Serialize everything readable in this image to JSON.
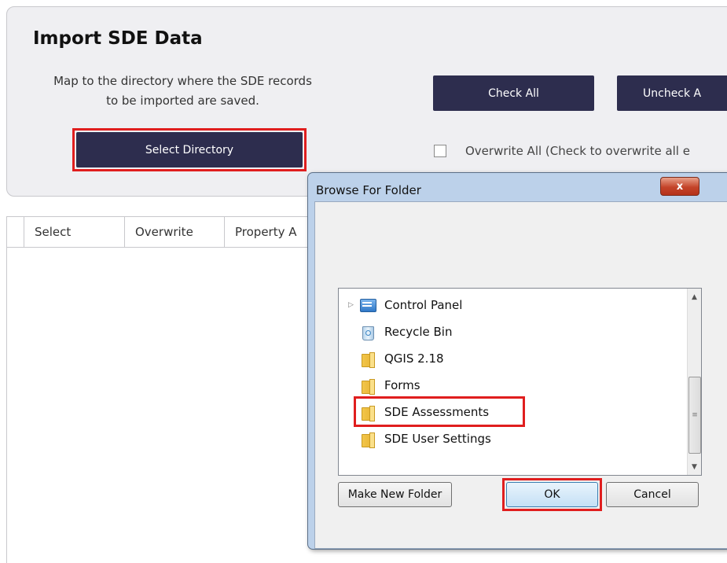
{
  "panel": {
    "title": "Import SDE Data",
    "description_line1": "Map to the directory where the SDE records",
    "description_line2": "to be imported are saved.",
    "select_directory_label": "Select Directory",
    "check_all_label": "Check All",
    "uncheck_all_label": "Uncheck A",
    "overwrite_label": "Overwrite All  (Check to overwrite all e"
  },
  "grid": {
    "columns": [
      "Select",
      "Overwrite",
      "Property A"
    ]
  },
  "dialog": {
    "title": "Browse For Folder",
    "close_label": "x",
    "items": [
      {
        "label": "Control Panel",
        "icon": "control-panel-icon"
      },
      {
        "label": "Recycle Bin",
        "icon": "recycle-bin-icon"
      },
      {
        "label": "QGIS 2.18",
        "icon": "folder-icon"
      },
      {
        "label": "Forms",
        "icon": "folder-icon"
      },
      {
        "label": "SDE Assessments",
        "icon": "folder-icon"
      },
      {
        "label": "SDE User Settings",
        "icon": "folder-icon"
      }
    ],
    "make_new_folder_label": "Make New Folder",
    "ok_label": "OK",
    "cancel_label": "Cancel"
  },
  "colors": {
    "button_dark": "#2d2d4e",
    "highlight_red": "#e01e1e",
    "dialog_frame": "#bcd1ea"
  }
}
